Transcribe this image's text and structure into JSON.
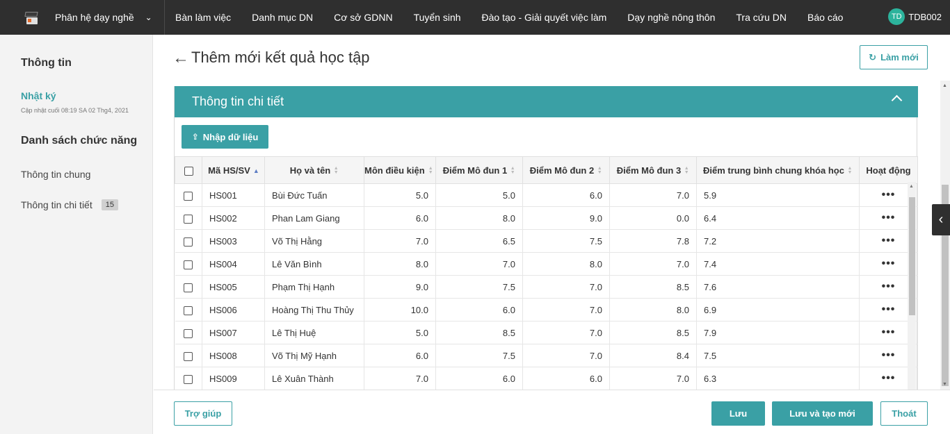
{
  "topbar": {
    "brand_title": "Phân hệ dạy nghề",
    "nav": [
      "Bàn làm việc",
      "Danh mục DN",
      "Cơ sở GDNN",
      "Tuyển sinh",
      "Đào tạo - Giải quyết việc làm",
      "Dạy nghề nông thôn",
      "Tra cứu DN",
      "Báo cáo"
    ],
    "user_initials": "TD",
    "username": "TDB002"
  },
  "sidebar": {
    "info_heading": "Thông tin",
    "log_link": "Nhật ký",
    "log_updated": "Cập nhật cuối 08:19 SA 02 Thg4, 2021",
    "functions_heading": "Danh sách chức năng",
    "items": [
      {
        "label": "Thông tin chung"
      },
      {
        "label": "Thông tin chi tiết",
        "badge": "15"
      }
    ]
  },
  "page": {
    "title": "Thêm mới kết quả học tập",
    "refresh_label": "Làm mới"
  },
  "panel": {
    "title": "Thông tin chi tiết",
    "import_label": "Nhập dữ liệu"
  },
  "table": {
    "headers": [
      "Mã HS/SV",
      "Họ và tên",
      "Môn điều kiện",
      "Điểm Mô đun 1",
      "Điểm Mô đun 2",
      "Điểm Mô đun 3",
      "Điểm trung bình chung khóa học",
      "Hoạt động"
    ],
    "rows": [
      {
        "code": "HS001",
        "name": "Bùi Đức Tuấn",
        "cond": "5.0",
        "m1": "5.0",
        "m2": "6.0",
        "m3": "7.0",
        "avg": "5.9",
        "action": "•••"
      },
      {
        "code": "HS002",
        "name": "Phan Lam Giang",
        "cond": "6.0",
        "m1": "8.0",
        "m2": "9.0",
        "m3": "0.0",
        "avg": "6.4",
        "action": "•••"
      },
      {
        "code": "HS003",
        "name": "Võ Thị Hằng",
        "cond": "7.0",
        "m1": "6.5",
        "m2": "7.5",
        "m3": "7.8",
        "avg": "7.2",
        "action": "•••"
      },
      {
        "code": "HS004",
        "name": "Lê Văn Bình",
        "cond": "8.0",
        "m1": "7.0",
        "m2": "8.0",
        "m3": "7.0",
        "avg": "7.4",
        "action": "•••"
      },
      {
        "code": "HS005",
        "name": "Phạm Thị Hạnh",
        "cond": "9.0",
        "m1": "7.5",
        "m2": "7.0",
        "m3": "8.5",
        "avg": "7.6",
        "action": "•••"
      },
      {
        "code": "HS006",
        "name": "Hoàng Thị Thu Thủy",
        "cond": "10.0",
        "m1": "6.0",
        "m2": "7.0",
        "m3": "8.0",
        "avg": "6.9",
        "action": "•••"
      },
      {
        "code": "HS007",
        "name": "Lê Thị Huệ",
        "cond": "5.0",
        "m1": "8.5",
        "m2": "7.0",
        "m3": "8.5",
        "avg": "7.9",
        "action": "•••"
      },
      {
        "code": "HS008",
        "name": "Võ Thị Mỹ Hạnh",
        "cond": "6.0",
        "m1": "7.5",
        "m2": "7.0",
        "m3": "8.4",
        "avg": "7.5",
        "action": "•••"
      },
      {
        "code": "HS009",
        "name": "Lê Xuân Thành",
        "cond": "7.0",
        "m1": "6.0",
        "m2": "6.0",
        "m3": "7.0",
        "avg": "6.3",
        "action": "•••"
      }
    ]
  },
  "footer": {
    "help_label": "Trợ giúp",
    "save_label": "Lưu",
    "save_new_label": "Lưu và tạo mới",
    "exit_label": "Thoát"
  },
  "colors": {
    "accent": "#3aa0a5",
    "topbar": "#2f2f2f",
    "avatar": "#2cb39c"
  }
}
